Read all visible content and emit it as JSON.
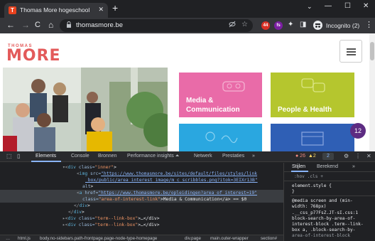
{
  "browser": {
    "tab_title": "Thomas More hogeschool",
    "tab_favicon": "T",
    "close_glyph": "✕",
    "new_tab_glyph": "+",
    "tab_search_glyph": "⌄",
    "window": {
      "minimize": "—",
      "maximize": "☐",
      "close": "✕"
    },
    "nav": {
      "back": "←",
      "forward": "→",
      "reload": "C",
      "home": "⌂"
    },
    "url": "thomasmore.be",
    "lock_glyph": "🔒",
    "extensions": [
      {
        "name": "sgt-extension",
        "badge": "44",
        "color": "#d93025"
      },
      {
        "name": "fs-extension",
        "badge": "fs",
        "color": "#7b1fa2"
      }
    ],
    "incognito_label": "Incognito (2)",
    "menu_glyph": "⋮"
  },
  "page": {
    "logo_top": "THOMAS",
    "logo_main": "MORE",
    "cards": [
      {
        "label_line1": "Media &",
        "label_line2": "Communication",
        "color": "#e96ba8"
      },
      {
        "label_line1": "People & Health",
        "label_line2": "",
        "color": "#b5c62e"
      },
      {
        "label_line1": "",
        "label_line2": "",
        "color": "#2aa7e0"
      },
      {
        "label_line1": "",
        "label_line2": "",
        "color": "#2f5fb5"
      }
    ],
    "badge_count": "12"
  },
  "devtools": {
    "tabs": [
      "Elements",
      "Console",
      "Bronnen",
      "Performance insights ⏶",
      "Netwerk",
      "Prestaties",
      "»"
    ],
    "errors": "● 26",
    "warnings": "▲2",
    "info": "2",
    "code_lines": [
      {
        "indent": 88,
        "pre": "▾<",
        "tag": "div",
        "attr": " class=",
        "val": "\"inner\"",
        "rest": ">"
      },
      {
        "indent": 108,
        "pre": "<",
        "tag": "img",
        "attr": " src=",
        "link": "\"https://www.thomasmore.be/sites/default/files/styles/link",
        "rest": ""
      },
      {
        "indent": 120,
        "pre": "",
        "tag": "",
        "attr": "",
        "link": "_box/public/area_interest_image/m_c_scribbles.png?itok=3EIXr13B\"",
        "rest": ""
      },
      {
        "indent": 116,
        "pre": "",
        "tag": "",
        "attr": "alt",
        "val": "",
        "rest": ">"
      },
      {
        "indent": 108,
        "pre": "<",
        "tag": "a",
        "attr": " href=",
        "link": "\"https://www.thomasmore.be/opleidingen?area_of_interest=19\"",
        "rest": "",
        "selected": true
      },
      {
        "indent": 116,
        "pre": "",
        "tag": "",
        "attr": "class=",
        "val": "\"area-of-interest-link\"",
        "rest": ">Media & Communication</a> == $0",
        "selected": true
      },
      {
        "indent": 104,
        "pre": "</",
        "tag": "div",
        "attr": "",
        "val": "",
        "rest": ">"
      },
      {
        "indent": 96,
        "pre": "</",
        "tag": "div",
        "attr": "",
        "val": "",
        "rest": ">"
      },
      {
        "indent": 88,
        "pre": "▸<",
        "tag": "div",
        "attr": " class=",
        "val": "\"term--link-box\"",
        "rest": ">…</div>"
      },
      {
        "indent": 88,
        "pre": "▸<",
        "tag": "div",
        "attr": " class=",
        "val": "\"term--link-box\"",
        "rest": ">…</div>"
      }
    ],
    "breadcrumbs": [
      "…",
      "html.js",
      "body.no-sidebars.path-frontpage.page-node-type-homepage",
      "div.page",
      "main.outer-wrapper",
      "section#"
    ],
    "styles": {
      "tabs": [
        "Stijlen",
        "Berekend",
        "»"
      ],
      "filter_hint": ":hov  .cls  +",
      "element_style": "element.style {",
      "close_brace": "}",
      "media_line1": "@media screen and (min-",
      "media_line2": "width: 768px)",
      "rule_line1": ".__css_p77FsZ.JT-sI.css:1",
      "rule_line2": "block-search-by-area-of-",
      "rule_line3": "interest-block .term--link-",
      "rule_line4": "box a, .block-search-by-",
      "rule_line5": "area-of-interest-block"
    }
  }
}
